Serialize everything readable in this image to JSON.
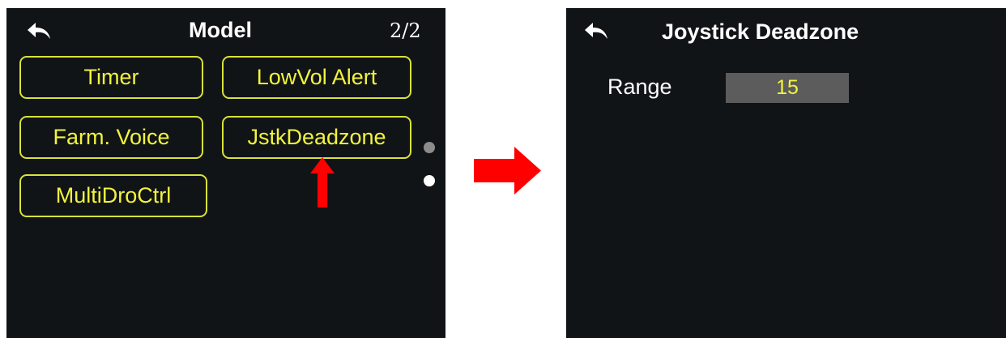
{
  "left_screen": {
    "title": "Model",
    "page_indicator": "2/2",
    "back_icon": "back-arrow-icon",
    "buttons": [
      {
        "label": "Timer"
      },
      {
        "label": "LowVol Alert"
      },
      {
        "label": "Farm. Voice"
      },
      {
        "label": "JstkDeadzone"
      },
      {
        "label": "MultiDroCtrl"
      }
    ],
    "page_dots": {
      "count": 2,
      "active_index": 1
    }
  },
  "right_screen": {
    "title": "Joystick Deadzone",
    "back_icon": "back-arrow-icon",
    "range": {
      "label": "Range",
      "value": "15"
    }
  },
  "colors": {
    "screen_bg": "#111417",
    "button_border": "#d9e23a",
    "button_text": "#f2f43c",
    "annotation_red": "#ff0000",
    "value_box": "#5c5c5c",
    "dot_inactive": "#8c8c8c",
    "dot_active": "#ffffff"
  }
}
